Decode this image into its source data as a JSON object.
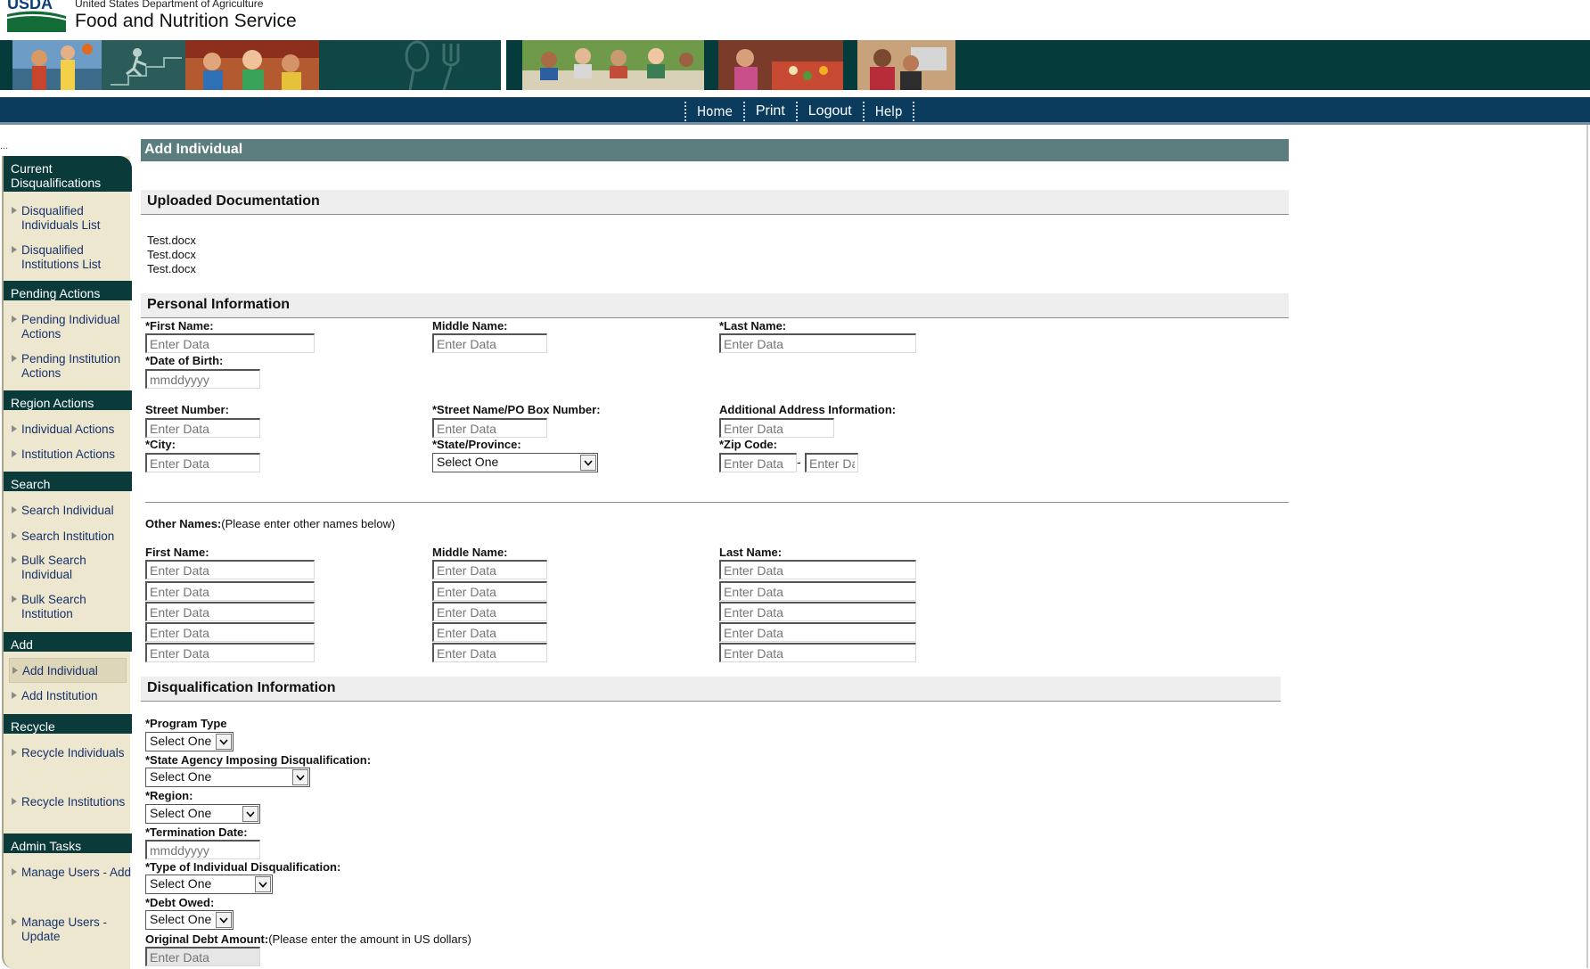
{
  "header": {
    "agency_top": "United States Department of Agriculture",
    "agency_name": "Food and Nutrition Service",
    "logo": "USDA",
    "banner_photos": [
      "basketball-kids",
      "exercise-figure",
      "cheering-kids",
      "utensils-graphic",
      "family-dinner",
      "family-cooking",
      "women-with-laptop"
    ]
  },
  "nav": {
    "home": "Home",
    "print": "Print",
    "logout": "Logout",
    "help": "Help"
  },
  "sidebar": {
    "dots": "...",
    "sections": [
      {
        "title": "Current Disqualifications",
        "items": [
          "Disqualified Individuals List",
          "Disqualified Institutions List"
        ]
      },
      {
        "title": "Pending Actions",
        "items": [
          "Pending Individual Actions",
          "Pending Institution Actions"
        ]
      },
      {
        "title": "Region Actions",
        "items": [
          "Individual Actions",
          "Institution Actions"
        ]
      },
      {
        "title": "Search",
        "items": [
          "Search Individual",
          "Search Institution",
          "Bulk Search Individual",
          "Bulk Search Institution"
        ]
      },
      {
        "title": "Add",
        "items": [
          "Add Individual",
          "Add Institution"
        ]
      },
      {
        "title": "Recycle",
        "items": [
          "Recycle Individuals",
          "Recycle Institutions"
        ]
      },
      {
        "title": "Admin Tasks",
        "items": [
          "Manage Users - Add",
          "Manage Users - Update"
        ]
      }
    ],
    "active_item": "Add Individual"
  },
  "page": {
    "title": "Add Individual",
    "uploaded": {
      "heading": "Uploaded Documentation",
      "files": [
        "Test.docx",
        "Test.docx",
        "Test.docx"
      ]
    },
    "personal": {
      "heading": "Personal Information",
      "first_name_label": "*First Name:",
      "middle_name_label": "Middle Name:",
      "last_name_label": "*Last Name:",
      "dob_label": "*Date of Birth:",
      "street_number_label": "Street Number:",
      "street_name_label": "*Street Name/PO Box Number:",
      "additional_address_label": "Additional Address Information:",
      "city_label": "*City:",
      "state_label": "*State/Province:",
      "zip_label": "*Zip Code:",
      "placeholder": "Enter Data",
      "date_placeholder": "mmddyyyy",
      "select_default": "Select One",
      "zip_dash": "-"
    },
    "other_names": {
      "label": "Other Names:",
      "note": "(Please enter other names below)",
      "first_label": "First Name:",
      "middle_label": "Middle Name:",
      "last_label": "Last Name:",
      "row_count_note": "5 rows"
    },
    "disqualification": {
      "heading": "Disqualification Information",
      "program_type_label": "*Program Type",
      "state_agency_label": "*State Agency Imposing Disqualification:",
      "region_label": "*Region:",
      "termination_label": "*Termination Date:",
      "type_label": "*Type of Individual Disqualification:",
      "debt_owed_label": "*Debt Owed:",
      "original_debt_label": "Original Debt Amount:",
      "original_debt_note": "(Please enter the amount in US dollars)"
    }
  },
  "colors": {
    "banner": "#063b3b",
    "navbar": "#0b3c5d",
    "title_bar": "#5c7d7e",
    "sidebar": "#ede7cf",
    "sidebar_head": "#0a3a3a"
  }
}
